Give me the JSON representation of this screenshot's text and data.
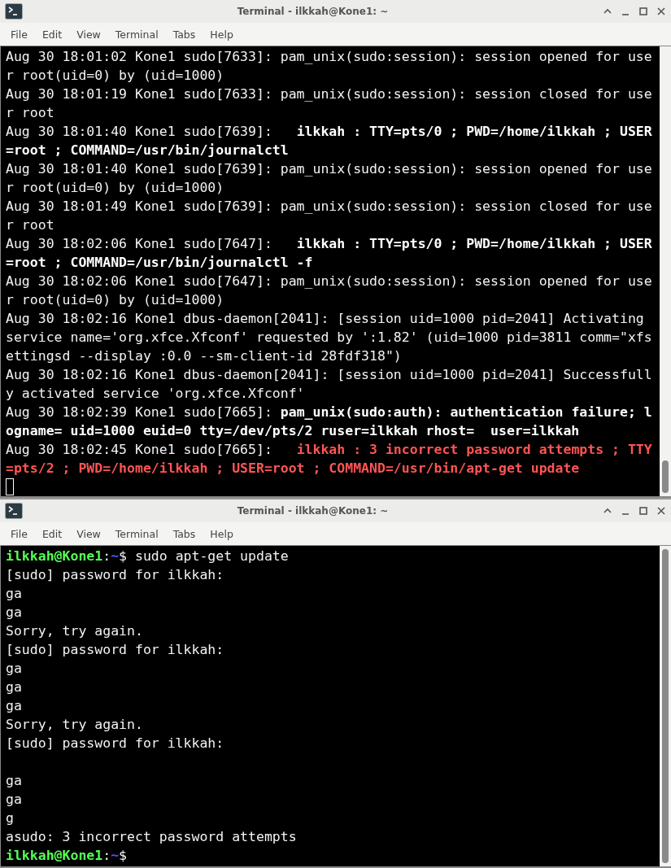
{
  "windows": [
    {
      "title": "Terminal - ilkkah@Kone1: ~",
      "menu": [
        "File",
        "Edit",
        "View",
        "Terminal",
        "Tabs",
        "Help"
      ],
      "lines": [
        {
          "kind": "text",
          "segments": [
            {
              "text": "Aug 30 18:01:02 Kone1 sudo[7633]: pam_unix(sudo:session): session opened for user root(uid=0) by (uid=1000)",
              "kind": "plain"
            }
          ]
        },
        {
          "kind": "text",
          "segments": [
            {
              "text": "Aug 30 18:01:19 Kone1 sudo[7633]: pam_unix(sudo:session): session closed for user root",
              "kind": "plain"
            }
          ]
        },
        {
          "kind": "text",
          "segments": [
            {
              "text": "Aug 30 18:01:40 Kone1 sudo[7639]:   ",
              "kind": "plain"
            },
            {
              "text": "ilkkah : TTY=pts/0 ; PWD=/home/ilkkah ; USER=root ; COMMAND=/usr/bin/journalctl",
              "kind": "bold"
            }
          ]
        },
        {
          "kind": "text",
          "segments": [
            {
              "text": "Aug 30 18:01:40 Kone1 sudo[7639]: pam_unix(sudo:session): session opened for user root(uid=0) by (uid=1000)",
              "kind": "plain"
            }
          ]
        },
        {
          "kind": "text",
          "segments": [
            {
              "text": "Aug 30 18:01:49 Kone1 sudo[7639]: pam_unix(sudo:session): session closed for user root",
              "kind": "plain"
            }
          ]
        },
        {
          "kind": "text",
          "segments": [
            {
              "text": "Aug 30 18:02:06 Kone1 sudo[7647]:   ",
              "kind": "plain"
            },
            {
              "text": "ilkkah : TTY=pts/0 ; PWD=/home/ilkkah ; USER=root ; COMMAND=/usr/bin/journalctl -f",
              "kind": "bold"
            }
          ]
        },
        {
          "kind": "text",
          "segments": [
            {
              "text": "Aug 30 18:02:06 Kone1 sudo[7647]: pam_unix(sudo:session): session opened for user root(uid=0) by (uid=1000)",
              "kind": "plain"
            }
          ]
        },
        {
          "kind": "text",
          "segments": [
            {
              "text": "Aug 30 18:02:16 Kone1 dbus-daemon[2041]: [session uid=1000 pid=2041] Activating service name='org.xfce.Xfconf' requested by ':1.82' (uid=1000 pid=3811 comm=\"xfsettingsd --display :0.0 --sm-client-id 28fdf318\")",
              "kind": "plain"
            }
          ]
        },
        {
          "kind": "text",
          "segments": [
            {
              "text": "Aug 30 18:02:16 Kone1 dbus-daemon[2041]: [session uid=1000 pid=2041] Successfully activated service 'org.xfce.Xfconf'",
              "kind": "plain"
            }
          ]
        },
        {
          "kind": "text",
          "segments": [
            {
              "text": "Aug 30 18:02:39 Kone1 sudo[7665]: ",
              "kind": "plain"
            },
            {
              "text": "pam_unix(sudo:auth): authentication failure; logname= uid=1000 euid=0 tty=/dev/pts/2 ruser=ilkkah rhost=  user=ilkkah",
              "kind": "bold"
            }
          ]
        },
        {
          "kind": "text",
          "segments": [
            {
              "text": "Aug 30 18:02:45 Kone1 sudo[7665]:   ",
              "kind": "plain"
            },
            {
              "text": "ilkkah : 3 incorrect password attempts ; TTY=pts/2 ; PWD=/home/ilkkah ; USER=root ; COMMAND=/usr/bin/apt-get update",
              "kind": "alert"
            }
          ]
        },
        {
          "kind": "cursor"
        }
      ]
    },
    {
      "title": "Terminal - ilkkah@Kone1: ~",
      "menu": [
        "File",
        "Edit",
        "View",
        "Terminal",
        "Tabs",
        "Help"
      ],
      "lines": [
        {
          "kind": "text",
          "segments": [
            {
              "text": "ilkkah@Kone1",
              "kind": "user"
            },
            {
              "text": ":",
              "kind": "plain"
            },
            {
              "text": "~",
              "kind": "path"
            },
            {
              "text": "$ sudo apt-get update",
              "kind": "plain"
            }
          ]
        },
        {
          "kind": "text",
          "segments": [
            {
              "text": "[sudo] password for ilkkah:",
              "kind": "plain"
            }
          ]
        },
        {
          "kind": "text",
          "segments": [
            {
              "text": "ga",
              "kind": "plain"
            }
          ]
        },
        {
          "kind": "text",
          "segments": [
            {
              "text": "ga",
              "kind": "plain"
            }
          ]
        },
        {
          "kind": "text",
          "segments": [
            {
              "text": "Sorry, try again.",
              "kind": "plain"
            }
          ]
        },
        {
          "kind": "text",
          "segments": [
            {
              "text": "[sudo] password for ilkkah:",
              "kind": "plain"
            }
          ]
        },
        {
          "kind": "text",
          "segments": [
            {
              "text": "ga",
              "kind": "plain"
            }
          ]
        },
        {
          "kind": "text",
          "segments": [
            {
              "text": "ga",
              "kind": "plain"
            }
          ]
        },
        {
          "kind": "text",
          "segments": [
            {
              "text": "ga",
              "kind": "plain"
            }
          ]
        },
        {
          "kind": "text",
          "segments": [
            {
              "text": "Sorry, try again.",
              "kind": "plain"
            }
          ]
        },
        {
          "kind": "text",
          "segments": [
            {
              "text": "[sudo] password for ilkkah:",
              "kind": "plain"
            }
          ]
        },
        {
          "kind": "blank"
        },
        {
          "kind": "text",
          "segments": [
            {
              "text": "ga",
              "kind": "plain"
            }
          ]
        },
        {
          "kind": "text",
          "segments": [
            {
              "text": "ga",
              "kind": "plain"
            }
          ]
        },
        {
          "kind": "text",
          "segments": [
            {
              "text": "g",
              "kind": "plain"
            }
          ]
        },
        {
          "kind": "text",
          "segments": [
            {
              "text": "asudo: 3 incorrect password attempts",
              "kind": "plain"
            }
          ]
        },
        {
          "kind": "text",
          "segments": [
            {
              "text": "ilkkah@Kone1",
              "kind": "user"
            },
            {
              "text": ":",
              "kind": "plain"
            },
            {
              "text": "~",
              "kind": "path"
            },
            {
              "text": "$",
              "kind": "plain"
            }
          ]
        }
      ]
    }
  ]
}
